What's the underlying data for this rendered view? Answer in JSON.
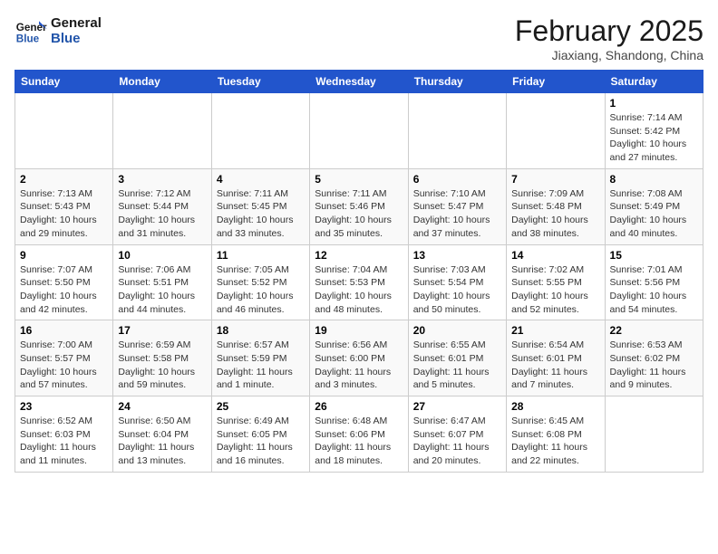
{
  "header": {
    "logo_line1": "General",
    "logo_line2": "Blue",
    "month_title": "February 2025",
    "location": "Jiaxiang, Shandong, China"
  },
  "weekdays": [
    "Sunday",
    "Monday",
    "Tuesday",
    "Wednesday",
    "Thursday",
    "Friday",
    "Saturday"
  ],
  "weeks": [
    [
      {
        "day": "",
        "info": ""
      },
      {
        "day": "",
        "info": ""
      },
      {
        "day": "",
        "info": ""
      },
      {
        "day": "",
        "info": ""
      },
      {
        "day": "",
        "info": ""
      },
      {
        "day": "",
        "info": ""
      },
      {
        "day": "1",
        "info": "Sunrise: 7:14 AM\nSunset: 5:42 PM\nDaylight: 10 hours and 27 minutes."
      }
    ],
    [
      {
        "day": "2",
        "info": "Sunrise: 7:13 AM\nSunset: 5:43 PM\nDaylight: 10 hours and 29 minutes."
      },
      {
        "day": "3",
        "info": "Sunrise: 7:12 AM\nSunset: 5:44 PM\nDaylight: 10 hours and 31 minutes."
      },
      {
        "day": "4",
        "info": "Sunrise: 7:11 AM\nSunset: 5:45 PM\nDaylight: 10 hours and 33 minutes."
      },
      {
        "day": "5",
        "info": "Sunrise: 7:11 AM\nSunset: 5:46 PM\nDaylight: 10 hours and 35 minutes."
      },
      {
        "day": "6",
        "info": "Sunrise: 7:10 AM\nSunset: 5:47 PM\nDaylight: 10 hours and 37 minutes."
      },
      {
        "day": "7",
        "info": "Sunrise: 7:09 AM\nSunset: 5:48 PM\nDaylight: 10 hours and 38 minutes."
      },
      {
        "day": "8",
        "info": "Sunrise: 7:08 AM\nSunset: 5:49 PM\nDaylight: 10 hours and 40 minutes."
      }
    ],
    [
      {
        "day": "9",
        "info": "Sunrise: 7:07 AM\nSunset: 5:50 PM\nDaylight: 10 hours and 42 minutes."
      },
      {
        "day": "10",
        "info": "Sunrise: 7:06 AM\nSunset: 5:51 PM\nDaylight: 10 hours and 44 minutes."
      },
      {
        "day": "11",
        "info": "Sunrise: 7:05 AM\nSunset: 5:52 PM\nDaylight: 10 hours and 46 minutes."
      },
      {
        "day": "12",
        "info": "Sunrise: 7:04 AM\nSunset: 5:53 PM\nDaylight: 10 hours and 48 minutes."
      },
      {
        "day": "13",
        "info": "Sunrise: 7:03 AM\nSunset: 5:54 PM\nDaylight: 10 hours and 50 minutes."
      },
      {
        "day": "14",
        "info": "Sunrise: 7:02 AM\nSunset: 5:55 PM\nDaylight: 10 hours and 52 minutes."
      },
      {
        "day": "15",
        "info": "Sunrise: 7:01 AM\nSunset: 5:56 PM\nDaylight: 10 hours and 54 minutes."
      }
    ],
    [
      {
        "day": "16",
        "info": "Sunrise: 7:00 AM\nSunset: 5:57 PM\nDaylight: 10 hours and 57 minutes."
      },
      {
        "day": "17",
        "info": "Sunrise: 6:59 AM\nSunset: 5:58 PM\nDaylight: 10 hours and 59 minutes."
      },
      {
        "day": "18",
        "info": "Sunrise: 6:57 AM\nSunset: 5:59 PM\nDaylight: 11 hours and 1 minute."
      },
      {
        "day": "19",
        "info": "Sunrise: 6:56 AM\nSunset: 6:00 PM\nDaylight: 11 hours and 3 minutes."
      },
      {
        "day": "20",
        "info": "Sunrise: 6:55 AM\nSunset: 6:01 PM\nDaylight: 11 hours and 5 minutes."
      },
      {
        "day": "21",
        "info": "Sunrise: 6:54 AM\nSunset: 6:01 PM\nDaylight: 11 hours and 7 minutes."
      },
      {
        "day": "22",
        "info": "Sunrise: 6:53 AM\nSunset: 6:02 PM\nDaylight: 11 hours and 9 minutes."
      }
    ],
    [
      {
        "day": "23",
        "info": "Sunrise: 6:52 AM\nSunset: 6:03 PM\nDaylight: 11 hours and 11 minutes."
      },
      {
        "day": "24",
        "info": "Sunrise: 6:50 AM\nSunset: 6:04 PM\nDaylight: 11 hours and 13 minutes."
      },
      {
        "day": "25",
        "info": "Sunrise: 6:49 AM\nSunset: 6:05 PM\nDaylight: 11 hours and 16 minutes."
      },
      {
        "day": "26",
        "info": "Sunrise: 6:48 AM\nSunset: 6:06 PM\nDaylight: 11 hours and 18 minutes."
      },
      {
        "day": "27",
        "info": "Sunrise: 6:47 AM\nSunset: 6:07 PM\nDaylight: 11 hours and 20 minutes."
      },
      {
        "day": "28",
        "info": "Sunrise: 6:45 AM\nSunset: 6:08 PM\nDaylight: 11 hours and 22 minutes."
      },
      {
        "day": "",
        "info": ""
      }
    ]
  ]
}
